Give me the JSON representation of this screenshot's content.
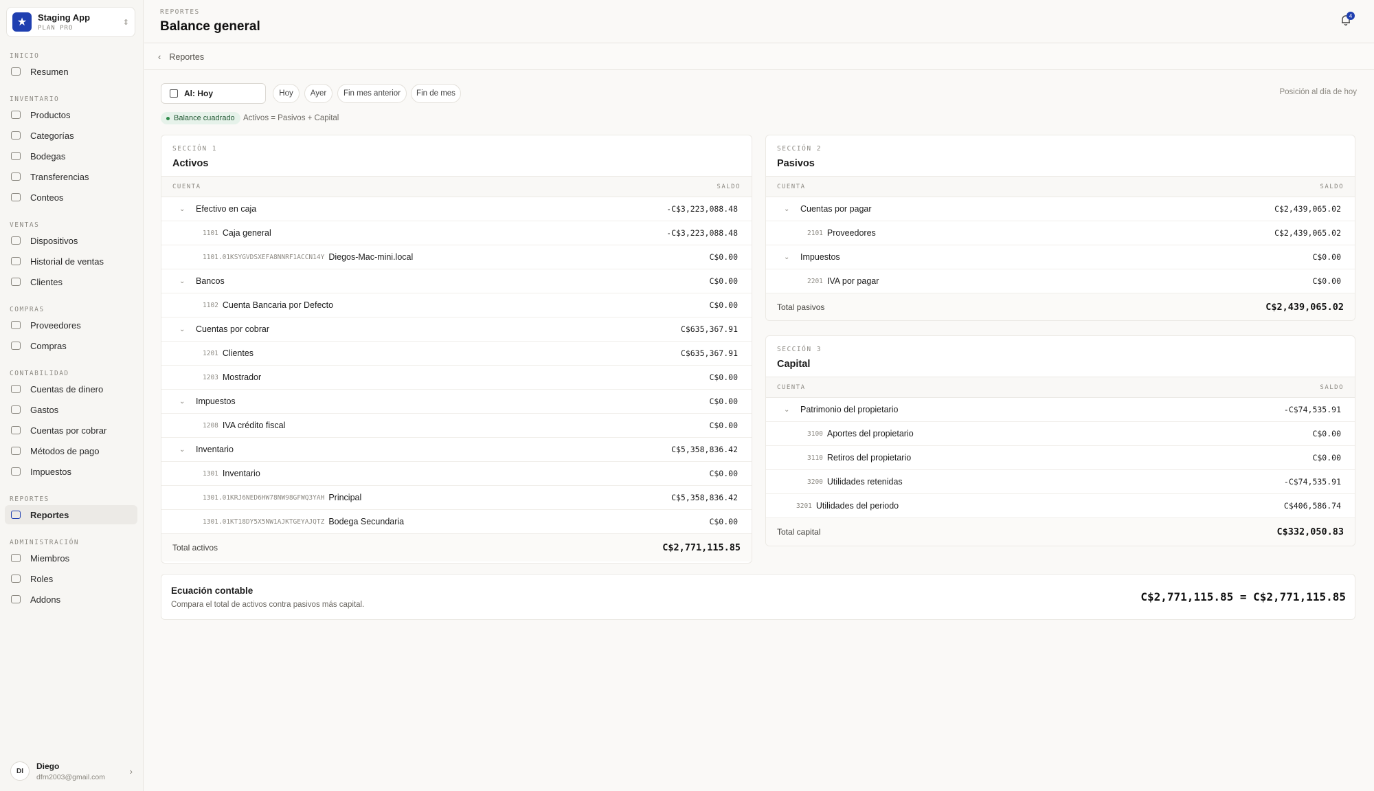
{
  "app": {
    "name": "Staging App",
    "plan": "PLAN PRO"
  },
  "nav": {
    "sections": [
      {
        "label": "INICIO",
        "items": [
          "Resumen"
        ]
      },
      {
        "label": "INVENTARIO",
        "items": [
          "Productos",
          "Categorías",
          "Bodegas",
          "Transferencias",
          "Conteos"
        ]
      },
      {
        "label": "VENTAS",
        "items": [
          "Dispositivos",
          "Historial de ventas",
          "Clientes"
        ]
      },
      {
        "label": "COMPRAS",
        "items": [
          "Proveedores",
          "Compras"
        ]
      },
      {
        "label": "CONTABILIDAD",
        "items": [
          "Cuentas de dinero",
          "Gastos",
          "Cuentas por cobrar",
          "Métodos de pago",
          "Impuestos"
        ]
      },
      {
        "label": "REPORTES",
        "items": [
          "Reportes"
        ]
      },
      {
        "label": "ADMINISTRACIÓN",
        "items": [
          "Miembros",
          "Roles",
          "Addons"
        ]
      }
    ],
    "active": "Reportes"
  },
  "user": {
    "initials": "DI",
    "name": "Diego",
    "email": "dfrn2003@gmail.com"
  },
  "header": {
    "eyebrow": "REPORTES",
    "title": "Balance general",
    "notifications": "4"
  },
  "breadcrumb": {
    "back_label": "Reportes"
  },
  "filters": {
    "date_label": "Al: Hoy",
    "chips": [
      "Hoy",
      "Ayer",
      "Fin mes anterior",
      "Fin de mes"
    ],
    "position_note": "Posición al día de hoy"
  },
  "status": {
    "badge": "Balance cuadrado",
    "equation": "Activos = Pasivos + Capital"
  },
  "columns": {
    "account": "CUENTA",
    "balance": "SALDO"
  },
  "assets": {
    "eyebrow": "SECCIÓN 1",
    "title": "Activos",
    "rows": [
      {
        "type": "group",
        "name": "Efectivo en caja",
        "amount": "-C$3,223,088.48"
      },
      {
        "type": "sub",
        "code": "1101",
        "name": "Caja general",
        "amount": "-C$3,223,088.48"
      },
      {
        "type": "sub",
        "code": "1101.01KSYGVDSXEFA8NNRF1ACCN14Y",
        "name": "Diegos-Mac-mini.local",
        "amount": "C$0.00"
      },
      {
        "type": "group",
        "name": "Bancos",
        "amount": "C$0.00"
      },
      {
        "type": "sub",
        "code": "1102",
        "name": "Cuenta Bancaria por Defecto",
        "amount": "C$0.00"
      },
      {
        "type": "group",
        "name": "Cuentas por cobrar",
        "amount": "C$635,367.91"
      },
      {
        "type": "sub",
        "code": "1201",
        "name": "Clientes",
        "amount": "C$635,367.91"
      },
      {
        "type": "sub",
        "code": "1203",
        "name": "Mostrador",
        "amount": "C$0.00"
      },
      {
        "type": "group",
        "name": "Impuestos",
        "amount": "C$0.00"
      },
      {
        "type": "sub",
        "code": "1208",
        "name": "IVA crédito fiscal",
        "amount": "C$0.00"
      },
      {
        "type": "group",
        "name": "Inventario",
        "amount": "C$5,358,836.42"
      },
      {
        "type": "sub",
        "code": "1301",
        "name": "Inventario",
        "amount": "C$0.00"
      },
      {
        "type": "sub",
        "code": "1301.01KRJ6NED6HW78NW98GFWQ3YAH",
        "name": "Principal",
        "amount": "C$5,358,836.42"
      },
      {
        "type": "sub",
        "code": "1301.01KT18DY5X5NW1AJKTGEYAJQTZ",
        "name": "Bodega Secundaria",
        "amount": "C$0.00"
      }
    ],
    "total_label": "Total activos",
    "total": "C$2,771,115.85"
  },
  "liabilities": {
    "eyebrow": "SECCIÓN 2",
    "title": "Pasivos",
    "rows": [
      {
        "type": "group",
        "name": "Cuentas por pagar",
        "amount": "C$2,439,065.02"
      },
      {
        "type": "sub",
        "code": "2101",
        "name": "Proveedores",
        "amount": "C$2,439,065.02"
      },
      {
        "type": "group",
        "name": "Impuestos",
        "amount": "C$0.00"
      },
      {
        "type": "sub",
        "code": "2201",
        "name": "IVA por pagar",
        "amount": "C$0.00"
      }
    ],
    "total_label": "Total pasivos",
    "total": "C$2,439,065.02"
  },
  "equity": {
    "eyebrow": "SECCIÓN 3",
    "title": "Capital",
    "rows": [
      {
        "type": "group",
        "name": "Patrimonio del propietario",
        "amount": "-C$74,535.91"
      },
      {
        "type": "sub",
        "code": "3100",
        "name": "Aportes del propietario",
        "amount": "C$0.00"
      },
      {
        "type": "sub",
        "code": "3110",
        "name": "Retiros del propietario",
        "amount": "C$0.00"
      },
      {
        "type": "sub",
        "code": "3200",
        "name": "Utilidades retenidas",
        "amount": "-C$74,535.91"
      },
      {
        "type": "plain",
        "code": "3201",
        "name": "Utilidades del periodo",
        "amount": "C$406,586.74"
      }
    ],
    "total_label": "Total capital",
    "total": "C$332,050.83"
  },
  "equation_card": {
    "title": "Ecuación contable",
    "subtitle": "Compara el total de activos contra pasivos más capital.",
    "value": "C$2,771,115.85 = C$2,771,115.85"
  }
}
